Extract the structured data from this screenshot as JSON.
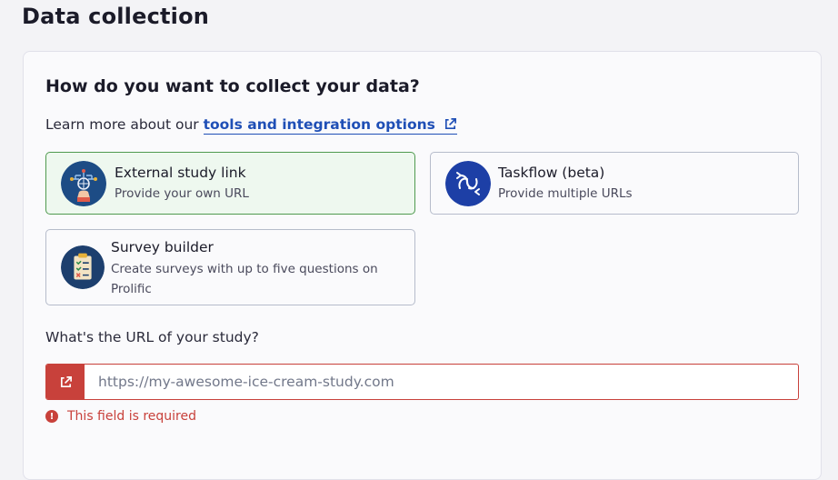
{
  "page": {
    "title": "Data collection"
  },
  "card": {
    "heading": "How do you want to collect your data?",
    "learn_prefix": "Learn more about our",
    "learn_link": "tools and integration options"
  },
  "options": [
    {
      "title": "External study link",
      "description": "Provide your own URL",
      "icon": "flowchart-hand-icon",
      "selected": true
    },
    {
      "title": "Taskflow (beta)",
      "description": "Provide multiple URLs",
      "icon": "linked-arrows-icon",
      "selected": false
    },
    {
      "title": "Survey builder",
      "description": "Create surveys with up to five questions on Prolific",
      "icon": "clipboard-checklist-icon",
      "selected": false
    }
  ],
  "url": {
    "label": "What's the URL of your study?",
    "placeholder": "https://my-awesome-ice-cream-study.com",
    "value": "",
    "error": "This field is required",
    "prefix_icon": "external-link-icon"
  },
  "colors": {
    "selected_border": "#4f9a4f",
    "selected_bg": "#eef8ef",
    "error": "#c8413b",
    "link": "#1f4fb6"
  }
}
